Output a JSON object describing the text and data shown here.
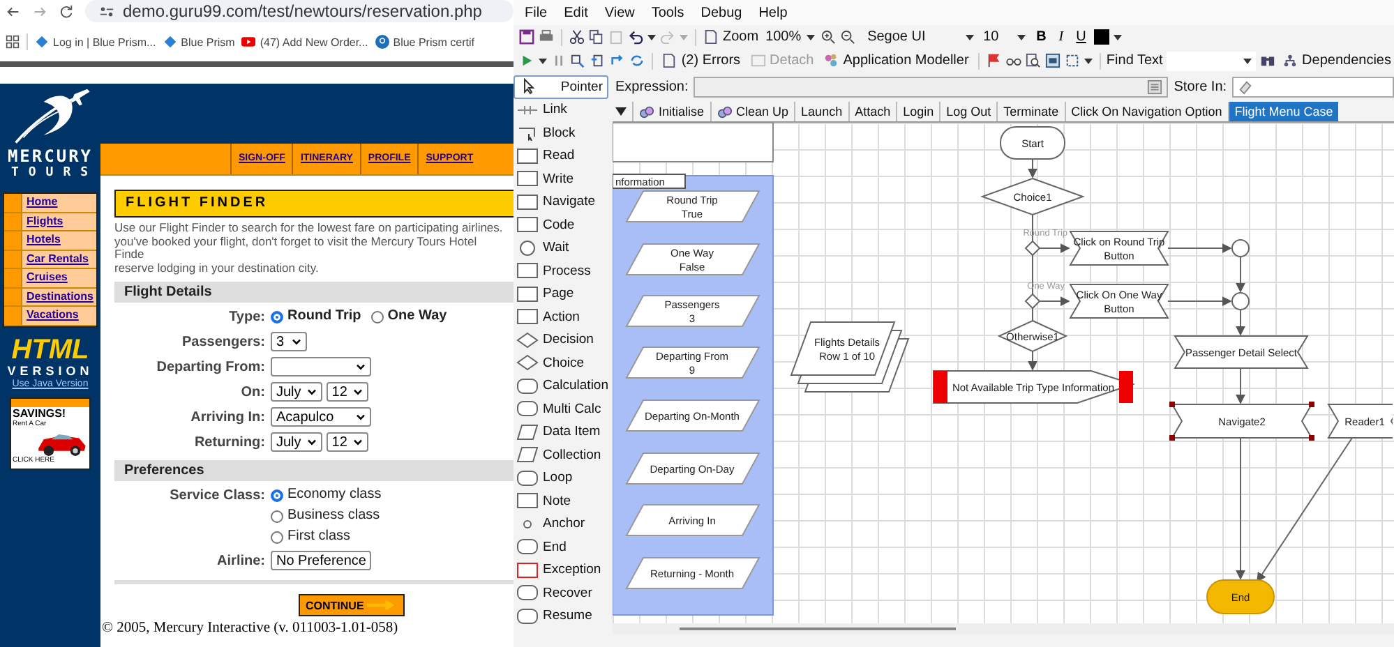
{
  "browser": {
    "url": "demo.guru99.com/test/newtours/reservation.php",
    "bookmarks": [
      {
        "label": "Log in | Blue Prism...",
        "kind": "prism"
      },
      {
        "label": "Blue Prism",
        "kind": "prism"
      },
      {
        "label": "(47) Add New Order...",
        "kind": "video"
      },
      {
        "label": "Blue Prism certif",
        "kind": "badge"
      }
    ]
  },
  "site": {
    "logo": {
      "name": "MERCURY",
      "sub": "TOURS"
    },
    "top_links": [
      "SIGN-OFF",
      "ITINERARY",
      "PROFILE",
      "SUPPORT"
    ],
    "side_links": [
      "Home",
      "Flights",
      "Hotels",
      "Car Rentals",
      "Cruises",
      "Destinations",
      "Vacations"
    ],
    "version": {
      "title": "HTML",
      "sub": "VERSION",
      "link": "Use Java Version"
    },
    "ad": {
      "title": "SAVINGS!",
      "sub": "Rent A Car",
      "link": "CLICK HERE"
    },
    "heading": "FLIGHT FINDER",
    "intro": [
      "Use our Flight Finder to search for the lowest fare on participating airlines.",
      "you've booked your flight, don't forget to visit the Mercury Tours Hotel Finde",
      "reserve lodging in your destination city."
    ],
    "sections": [
      {
        "title": "Flight Details",
        "rows": [
          {
            "label": "Type:",
            "kind": "radio",
            "options": [
              {
                "label": "Round Trip",
                "selected": true
              },
              {
                "label": "One Way",
                "selected": false
              }
            ]
          },
          {
            "label": "Passengers:",
            "kind": "select",
            "selects": [
              "3"
            ]
          },
          {
            "label": "Departing From:",
            "kind": "empty-select"
          },
          {
            "label": "On:",
            "kind": "select",
            "selects": [
              "July",
              "12"
            ]
          },
          {
            "label": "Arriving In:",
            "kind": "select",
            "selects": [
              "Acapulco"
            ]
          },
          {
            "label": "Returning:",
            "kind": "select",
            "selects": [
              "July",
              "12"
            ]
          }
        ]
      },
      {
        "title": "Preferences",
        "rows": [
          {
            "label": "Service Class:",
            "kind": "radio-list",
            "options": [
              {
                "label": "Economy class",
                "selected": true
              },
              {
                "label": "Business class",
                "selected": false
              },
              {
                "label": "First class",
                "selected": false
              }
            ]
          },
          {
            "label": "Airline:",
            "kind": "select",
            "selects": [
              "No Preference"
            ]
          }
        ]
      }
    ],
    "button": "CONTINUE",
    "footer": "© 2005, Mercury Interactive (v. 011003-1.01-058)"
  },
  "studio": {
    "menu": [
      "File",
      "Edit",
      "View",
      "Tools",
      "Debug",
      "Help"
    ],
    "toolbar": {
      "zoom_label": "Zoom",
      "zoom": "100%",
      "font": "Segoe UI",
      "size": "10",
      "format": [
        "B",
        "I",
        "U"
      ]
    },
    "debug_buttons": [
      {
        "label": "(2) Errors",
        "disabled": false
      },
      {
        "label": "Detach",
        "disabled": true
      },
      {
        "label": "Application Modeller",
        "disabled": false
      }
    ],
    "find_label": "Find Text",
    "dependencies": "Dependencies",
    "expression_label": "Expression:",
    "store_label": "Store In:",
    "palette": [
      {
        "label": "Pointer",
        "kind": "pointer",
        "selected": true
      },
      {
        "label": "Link",
        "kind": "link",
        "selected": false
      },
      {
        "label": "Block",
        "kind": "block",
        "selected": false
      },
      {
        "label": "Read",
        "kind": "rect",
        "selected": false
      },
      {
        "label": "Write",
        "kind": "rect",
        "selected": false
      },
      {
        "label": "Navigate",
        "kind": "rect",
        "selected": false
      },
      {
        "label": "Code",
        "kind": "rect",
        "selected": false
      },
      {
        "label": "Wait",
        "kind": "circle",
        "selected": false
      },
      {
        "label": "Process",
        "kind": "rect",
        "selected": false
      },
      {
        "label": "Page",
        "kind": "rect",
        "selected": false
      },
      {
        "label": "Action",
        "kind": "rect",
        "selected": false
      },
      {
        "label": "Decision",
        "kind": "diamond",
        "selected": false
      },
      {
        "label": "Choice",
        "kind": "diamond",
        "selected": false
      },
      {
        "label": "Calculation",
        "kind": "rounded",
        "selected": false
      },
      {
        "label": "Multi Calc",
        "kind": "rounded",
        "selected": false
      },
      {
        "label": "Data Item",
        "kind": "parallelogram",
        "selected": false
      },
      {
        "label": "Collection",
        "kind": "parallelogram",
        "selected": false
      },
      {
        "label": "Loop",
        "kind": "rounded",
        "selected": false
      },
      {
        "label": "Note",
        "kind": "rect",
        "selected": false
      },
      {
        "label": "Anchor",
        "kind": "dot",
        "selected": false
      },
      {
        "label": "End",
        "kind": "rounded",
        "selected": false
      },
      {
        "label": "Exception",
        "kind": "exception",
        "selected": false
      },
      {
        "label": "Recover",
        "kind": "rounded",
        "selected": false
      },
      {
        "label": "Resume",
        "kind": "rounded",
        "selected": false
      }
    ],
    "tabs": [
      {
        "label": "Initialise",
        "kind": "main",
        "selected": false
      },
      {
        "label": "Clean Up",
        "kind": "main",
        "selected": false
      },
      {
        "label": "Launch",
        "kind": "page",
        "selected": false
      },
      {
        "label": "Attach",
        "kind": "page",
        "selected": false
      },
      {
        "label": "Login",
        "kind": "page",
        "selected": false
      },
      {
        "label": "Log Out",
        "kind": "page",
        "selected": false
      },
      {
        "label": "Terminate",
        "kind": "page",
        "selected": false
      },
      {
        "label": "Click On Navigation Option",
        "kind": "page",
        "selected": false
      },
      {
        "label": "Flight Menu Case",
        "kind": "page",
        "selected": true
      }
    ],
    "canvas": {
      "block_label": "nformation",
      "data_items": [
        {
          "lines": [
            "Round Trip",
            "True"
          ]
        },
        {
          "lines": [
            "One Way",
            "False"
          ]
        },
        {
          "lines": [
            "Passengers",
            "3"
          ]
        },
        {
          "lines": [
            "Departing From",
            "9"
          ]
        },
        {
          "lines": [
            "Departing On-Month"
          ]
        },
        {
          "lines": [
            "Departing On-Day"
          ]
        },
        {
          "lines": [
            "Arriving In"
          ]
        },
        {
          "lines": [
            "Returning - Month"
          ]
        }
      ],
      "edge_labels": [
        "Round Trip",
        "One Way"
      ],
      "nodes": [
        {
          "kind": "start",
          "lines": [
            "Start"
          ],
          "selected": false
        },
        {
          "kind": "decision",
          "lines": [
            "Choice1"
          ],
          "selected": false
        },
        {
          "kind": "navigate",
          "lines": [
            "Click on Round Trip",
            "Button"
          ],
          "selected": false
        },
        {
          "kind": "navigate",
          "lines": [
            "Click On One Way",
            "Button"
          ],
          "selected": false
        },
        {
          "kind": "decision",
          "lines": [
            "Otherwise1"
          ],
          "selected": false
        },
        {
          "kind": "collection",
          "lines": [
            "Flights Details",
            "Row 1 of 10"
          ],
          "selected": false
        },
        {
          "kind": "exception",
          "lines": [
            "Not Available Trip Type Information"
          ],
          "selected": false
        },
        {
          "kind": "navigate",
          "lines": [
            "Passenger Detail Select"
          ],
          "selected": false
        },
        {
          "kind": "navigate",
          "lines": [
            "Navigate2"
          ],
          "selected": true
        },
        {
          "kind": "navigate",
          "lines": [
            "Reader1"
          ],
          "selected": false
        },
        {
          "kind": "end",
          "lines": [
            "End"
          ],
          "selected": false
        }
      ]
    }
  }
}
